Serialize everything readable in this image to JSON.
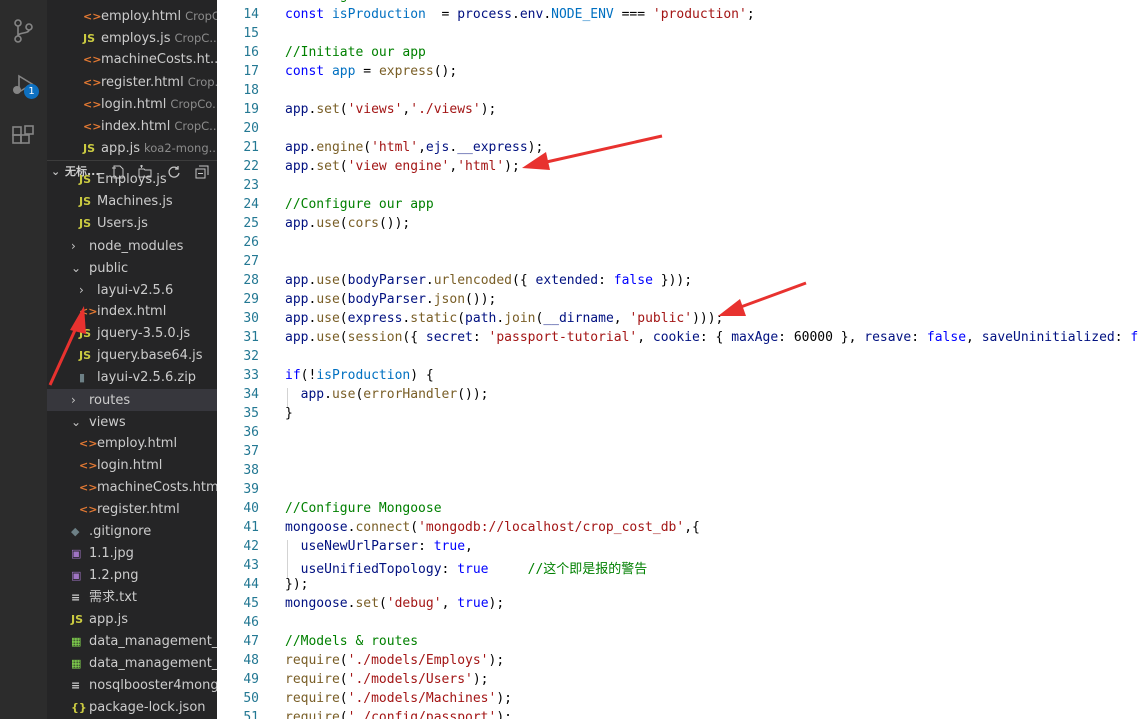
{
  "activity_bar": {
    "icons": [
      "source-control-icon",
      "run-debug-icon",
      "extensions-icon"
    ],
    "debug_badge": "1"
  },
  "explorer": {
    "open_editors": [
      {
        "name": "employ.html",
        "desc": "CropC...",
        "type": "html"
      },
      {
        "name": "employs.js",
        "desc": "CropC...",
        "type": "js"
      },
      {
        "name": "machineCosts.ht...",
        "desc": "",
        "type": "html"
      },
      {
        "name": "register.html",
        "desc": "Crop...",
        "type": "html"
      },
      {
        "name": "login.html",
        "desc": "CropCo...",
        "type": "html"
      },
      {
        "name": "index.html",
        "desc": "CropC...",
        "type": "html"
      },
      {
        "name": "app.js",
        "desc": "koa2-mong...",
        "type": "js"
      }
    ],
    "section_title": "无标...",
    "tree": [
      {
        "name": "Employs.js",
        "type": "js",
        "indent": 2
      },
      {
        "name": "Machines.js",
        "type": "js",
        "indent": 2
      },
      {
        "name": "Users.js",
        "type": "js",
        "indent": 2
      },
      {
        "name": "node_modules",
        "type": "folder-closed",
        "indent": 1
      },
      {
        "name": "public",
        "type": "folder-open",
        "indent": 1
      },
      {
        "name": "layui-v2.5.6",
        "type": "folder-closed",
        "indent": 2
      },
      {
        "name": "index.html",
        "type": "html",
        "indent": 2
      },
      {
        "name": "jquery-3.5.0.js",
        "type": "js",
        "indent": 2
      },
      {
        "name": "jquery.base64.js",
        "type": "js",
        "indent": 2
      },
      {
        "name": "layui-v2.5.6.zip",
        "type": "zip",
        "indent": 2
      },
      {
        "name": "routes",
        "type": "folder-closed",
        "indent": 1,
        "selected": true
      },
      {
        "name": "views",
        "type": "folder-open",
        "indent": 1
      },
      {
        "name": "employ.html",
        "type": "html",
        "indent": 2
      },
      {
        "name": "login.html",
        "type": "html",
        "indent": 2
      },
      {
        "name": "machineCosts.html",
        "type": "html",
        "indent": 2
      },
      {
        "name": "register.html",
        "type": "html",
        "indent": 2
      },
      {
        "name": ".gitignore",
        "type": "git",
        "indent": 1
      },
      {
        "name": "1.1.jpg",
        "type": "img",
        "indent": 1
      },
      {
        "name": "1.2.png",
        "type": "img",
        "indent": 1
      },
      {
        "name": "需求.txt",
        "type": "txt",
        "indent": 1
      },
      {
        "name": "app.js",
        "type": "js",
        "indent": 1
      },
      {
        "name": "data_management_...",
        "type": "xls",
        "indent": 1
      },
      {
        "name": "data_management_...",
        "type": "xls",
        "indent": 1
      },
      {
        "name": "nosqlbooster4mong...",
        "type": "txt",
        "indent": 1
      },
      {
        "name": "package-lock.json",
        "type": "json",
        "indent": 1
      }
    ]
  },
  "editor": {
    "lines": [
      {
        "n": "13",
        "t": [
          [
            "cm",
            "//Configure isProduction variable"
          ]
        ]
      },
      {
        "n": "14",
        "t": [
          [
            "kw",
            "const "
          ],
          [
            "cs",
            "isProduction"
          ],
          [
            "",
            "  = "
          ],
          [
            "vr",
            "process"
          ],
          [
            "",
            "."
          ],
          [
            "vr",
            "env"
          ],
          [
            "",
            "."
          ],
          [
            "cs",
            "NODE_ENV"
          ],
          [
            "",
            " === "
          ],
          [
            "str",
            "'production'"
          ],
          [
            "",
            ";"
          ]
        ]
      },
      {
        "n": "15",
        "t": []
      },
      {
        "n": "16",
        "t": [
          [
            "cm",
            "//Initiate our app"
          ]
        ]
      },
      {
        "n": "17",
        "t": [
          [
            "kw",
            "const "
          ],
          [
            "cs",
            "app"
          ],
          [
            "",
            " = "
          ],
          [
            "fn",
            "express"
          ],
          [
            "",
            "();"
          ]
        ]
      },
      {
        "n": "18",
        "t": []
      },
      {
        "n": "19",
        "t": [
          [
            "vr",
            "app"
          ],
          [
            "",
            "."
          ],
          [
            "fn",
            "set"
          ],
          [
            "",
            "("
          ],
          [
            "str",
            "'views'"
          ],
          [
            "",
            ","
          ],
          [
            "str",
            "'./views'"
          ],
          [
            "",
            ");"
          ]
        ]
      },
      {
        "n": "20",
        "t": []
      },
      {
        "n": "21",
        "t": [
          [
            "vr",
            "app"
          ],
          [
            "",
            "."
          ],
          [
            "fn",
            "engine"
          ],
          [
            "",
            "("
          ],
          [
            "str",
            "'html'"
          ],
          [
            "",
            ","
          ],
          [
            "vr",
            "ejs"
          ],
          [
            "",
            "."
          ],
          [
            "vr",
            "__express"
          ],
          [
            "",
            ");"
          ]
        ]
      },
      {
        "n": "22",
        "t": [
          [
            "vr",
            "app"
          ],
          [
            "",
            "."
          ],
          [
            "fn",
            "set"
          ],
          [
            "",
            "("
          ],
          [
            "str",
            "'view engine'"
          ],
          [
            "",
            ","
          ],
          [
            "str",
            "'html'"
          ],
          [
            "",
            ");"
          ]
        ]
      },
      {
        "n": "23",
        "t": []
      },
      {
        "n": "24",
        "t": [
          [
            "cm",
            "//Configure our app"
          ]
        ]
      },
      {
        "n": "25",
        "t": [
          [
            "vr",
            "app"
          ],
          [
            "",
            "."
          ],
          [
            "fn",
            "use"
          ],
          [
            "",
            "("
          ],
          [
            "fn",
            "cors"
          ],
          [
            "",
            "());"
          ]
        ]
      },
      {
        "n": "26",
        "t": []
      },
      {
        "n": "27",
        "t": []
      },
      {
        "n": "28",
        "t": [
          [
            "vr",
            "app"
          ],
          [
            "",
            "."
          ],
          [
            "fn",
            "use"
          ],
          [
            "",
            "("
          ],
          [
            "vr",
            "bodyParser"
          ],
          [
            "",
            "."
          ],
          [
            "fn",
            "urlencoded"
          ],
          [
            "",
            "({ "
          ],
          [
            "vr",
            "extended"
          ],
          [
            "",
            ": "
          ],
          [
            "kw",
            "false"
          ],
          [
            "",
            " }));"
          ]
        ]
      },
      {
        "n": "29",
        "t": [
          [
            "vr",
            "app"
          ],
          [
            "",
            "."
          ],
          [
            "fn",
            "use"
          ],
          [
            "",
            "("
          ],
          [
            "vr",
            "bodyParser"
          ],
          [
            "",
            "."
          ],
          [
            "fn",
            "json"
          ],
          [
            "",
            "());"
          ]
        ]
      },
      {
        "n": "30",
        "t": [
          [
            "vr",
            "app"
          ],
          [
            "",
            "."
          ],
          [
            "fn",
            "use"
          ],
          [
            "",
            "("
          ],
          [
            "vr",
            "express"
          ],
          [
            "",
            "."
          ],
          [
            "fn",
            "static"
          ],
          [
            "",
            "("
          ],
          [
            "vr",
            "path"
          ],
          [
            "",
            "."
          ],
          [
            "fn",
            "join"
          ],
          [
            "",
            "("
          ],
          [
            "vr",
            "__dirname"
          ],
          [
            "",
            ", "
          ],
          [
            "str",
            "'public'"
          ],
          [
            "",
            ")));"
          ]
        ]
      },
      {
        "n": "31",
        "t": [
          [
            "vr",
            "app"
          ],
          [
            "",
            "."
          ],
          [
            "fn",
            "use"
          ],
          [
            "",
            "("
          ],
          [
            "fn",
            "session"
          ],
          [
            "",
            "({ "
          ],
          [
            "vr",
            "secret"
          ],
          [
            "",
            ": "
          ],
          [
            "str",
            "'passport-tutorial'"
          ],
          [
            "",
            ", "
          ],
          [
            "vr",
            "cookie"
          ],
          [
            "",
            ": { "
          ],
          [
            "vr",
            "maxAge"
          ],
          [
            "",
            ": "
          ],
          [
            "",
            "60000"
          ],
          [
            "",
            " }, "
          ],
          [
            "vr",
            "resave"
          ],
          [
            "",
            ": "
          ],
          [
            "kw",
            "false"
          ],
          [
            "",
            ", "
          ],
          [
            "vr",
            "saveUninitialized"
          ],
          [
            "",
            ": "
          ],
          [
            "kw",
            "false"
          ],
          [
            "",
            " }));"
          ]
        ]
      },
      {
        "n": "32",
        "t": []
      },
      {
        "n": "33",
        "t": [
          [
            "kw",
            "if"
          ],
          [
            "",
            "(!"
          ],
          [
            "cs",
            "isProduction"
          ],
          [
            "",
            ") {"
          ]
        ]
      },
      {
        "n": "34",
        "t": [
          [
            "",
            "  "
          ],
          [
            "vr",
            "app"
          ],
          [
            "",
            "."
          ],
          [
            "fn",
            "use"
          ],
          [
            "",
            "("
          ],
          [
            "fn",
            "errorHandler"
          ],
          [
            "",
            "());"
          ]
        ]
      },
      {
        "n": "35",
        "t": [
          [
            "",
            "}"
          ]
        ]
      },
      {
        "n": "36",
        "t": []
      },
      {
        "n": "37",
        "t": []
      },
      {
        "n": "38",
        "t": []
      },
      {
        "n": "39",
        "t": []
      },
      {
        "n": "40",
        "t": [
          [
            "cm",
            "//Configure Mongoose"
          ]
        ]
      },
      {
        "n": "41",
        "t": [
          [
            "vr",
            "mongoose"
          ],
          [
            "",
            "."
          ],
          [
            "fn",
            "connect"
          ],
          [
            "",
            "("
          ],
          [
            "str",
            "'mongodb://localhost/crop_cost_db'"
          ],
          [
            "",
            ",{"
          ]
        ]
      },
      {
        "n": "42",
        "t": [
          [
            "",
            "  "
          ],
          [
            "vr",
            "useNewUrlParser"
          ],
          [
            "",
            ": "
          ],
          [
            "kw",
            "true"
          ],
          [
            "",
            ","
          ]
        ]
      },
      {
        "n": "43",
        "t": [
          [
            "",
            "  "
          ],
          [
            "vr",
            "useUnifiedTopology"
          ],
          [
            "",
            ": "
          ],
          [
            "kw",
            "true"
          ],
          [
            "",
            "     "
          ],
          [
            "cm",
            "//这个即是报的警告"
          ]
        ]
      },
      {
        "n": "44",
        "t": [
          [
            "",
            "});"
          ]
        ]
      },
      {
        "n": "45",
        "t": [
          [
            "vr",
            "mongoose"
          ],
          [
            "",
            "."
          ],
          [
            "fn",
            "set"
          ],
          [
            "",
            "("
          ],
          [
            "str",
            "'debug'"
          ],
          [
            "",
            ", "
          ],
          [
            "kw",
            "true"
          ],
          [
            "",
            ");"
          ]
        ]
      },
      {
        "n": "46",
        "t": []
      },
      {
        "n": "47",
        "t": [
          [
            "cm",
            "//Models & routes"
          ]
        ]
      },
      {
        "n": "48",
        "t": [
          [
            "fn",
            "require"
          ],
          [
            "",
            "("
          ],
          [
            "str",
            "'./models/Employs'"
          ],
          [
            "",
            ");"
          ]
        ]
      },
      {
        "n": "49",
        "t": [
          [
            "fn",
            "require"
          ],
          [
            "",
            "("
          ],
          [
            "str",
            "'./models/Users'"
          ],
          [
            "",
            ");"
          ]
        ]
      },
      {
        "n": "50",
        "t": [
          [
            "fn",
            "require"
          ],
          [
            "",
            "("
          ],
          [
            "str",
            "'./models/Machines'"
          ],
          [
            "",
            ");"
          ]
        ]
      },
      {
        "n": "51",
        "t": [
          [
            "fn",
            "require"
          ],
          [
            "",
            "("
          ],
          [
            "str",
            "'./config/passport'"
          ],
          [
            "",
            ");"
          ]
        ]
      }
    ]
  },
  "colors": {
    "annotation_arrow": "#e8322f"
  }
}
